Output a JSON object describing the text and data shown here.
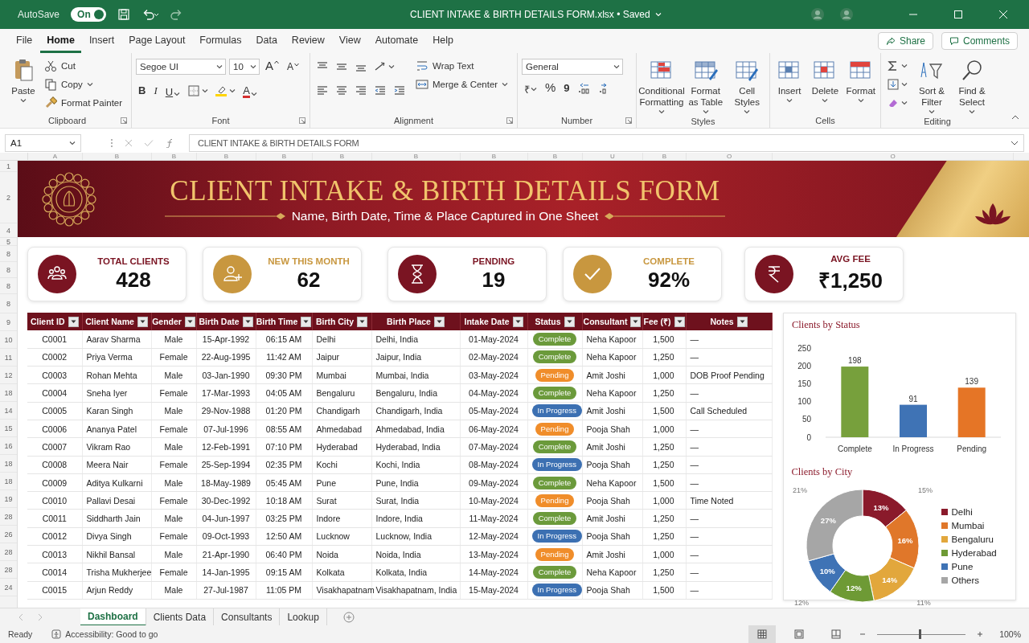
{
  "titlebar": {
    "autosave_label": "AutoSave",
    "autosave": {
      "label": "On",
      "on": true
    },
    "title": "CLIENT INTAKE & BIRTH DETAILS FORM.xlsx • Saved"
  },
  "menu_tabs": [
    {
      "label": "File",
      "selected": false
    },
    {
      "label": "Home",
      "selected": true
    },
    {
      "label": "Insert",
      "selected": false
    },
    {
      "label": "Page Layout",
      "selected": false
    },
    {
      "label": "Formulas",
      "selected": false
    },
    {
      "label": "Data",
      "selected": false
    },
    {
      "label": "Review",
      "selected": false
    },
    {
      "label": "View",
      "selected": false
    },
    {
      "label": "Automate",
      "selected": false
    },
    {
      "label": "Help",
      "selected": false
    }
  ],
  "share_button": "Share",
  "comments_button": "Comments",
  "ribbon": {
    "groups": [
      {
        "label": "Clipboard",
        "items": [
          "Paste",
          "Cut",
          "Copy",
          "Format Painter"
        ]
      },
      {
        "label": "Font",
        "items": [
          "Segoe UI",
          "10",
          "A",
          "A",
          "B",
          "I",
          "U",
          "A"
        ]
      },
      {
        "label": "Alignment",
        "items": [
          "Wrap Text",
          "Merge & Center"
        ]
      },
      {
        "label": "Number",
        "items": [
          "General",
          "₹",
          "%",
          "9"
        ]
      },
      {
        "label": "Styles",
        "items": [
          "Conditional Formatting",
          "Format as Table",
          "Cell Styles"
        ]
      },
      {
        "label": "Cells",
        "items": [
          "Insert",
          "Delete",
          "Format"
        ]
      },
      {
        "label": "Editing",
        "items": [
          "Sort & Filter",
          "Find & Select"
        ]
      }
    ]
  },
  "formula_bar": {
    "name_box": "A1",
    "formula": "CLIENT INTAKE & BIRTH DETAILS FORM"
  },
  "column_letters": [
    "A",
    "B",
    "B",
    "B",
    "B",
    "B",
    "B",
    "B",
    "B",
    "U",
    "B",
    "O",
    "O"
  ],
  "row_numbers": [
    "1",
    "2",
    "4",
    "5",
    "8",
    "8",
    "8",
    "8",
    "9",
    "10",
    "11",
    "12",
    "18",
    "14",
    "15",
    "16",
    "18",
    "18",
    "19",
    "28",
    "26",
    "28",
    "28",
    "24"
  ],
  "banner": {
    "title": "CLIENT INTAKE & BIRTH DETAILS FORM",
    "subtitle": "Name, Birth Date, Time & Place Captured in One Sheet"
  },
  "kpis": [
    {
      "label": "TOTAL CLIENTS",
      "value": "428",
      "color": "#7a1422"
    },
    {
      "label": "NEW THIS MONTH",
      "value": "62",
      "color": "#c8973f"
    },
    {
      "label": "PENDING",
      "value": "19",
      "color": "#7a1422"
    },
    {
      "label": "COMPLETE",
      "value": "92%",
      "color": "#c8973f"
    },
    {
      "label": "AVG FEE",
      "value": "₹1,250",
      "color": "#7a1422"
    }
  ],
  "table": {
    "columns": [
      "Client ID",
      "Client Name",
      "Gender",
      "Birth Date",
      "Birth Time",
      "Birth City",
      "Birth Place",
      "Intake Date",
      "Status",
      "Consultant",
      "Fee (₹)",
      "Notes"
    ],
    "rows": [
      {
        "cells": [
          "C0001",
          "Aarav Sharma",
          "Male",
          "15-Apr-1992",
          "06:15 AM",
          "Delhi",
          "Delhi, India",
          "01-May-2024"
        ],
        "status": {
          "label": "Complete",
          "kind": "complete"
        },
        "rest": [
          "Neha Kapoor",
          "1,500",
          "—"
        ]
      },
      {
        "cells": [
          "C0002",
          "Priya Verma",
          "Female",
          "22-Aug-1995",
          "11:42 AM",
          "Jaipur",
          "Jaipur, India",
          "02-May-2024"
        ],
        "status": {
          "label": "Complete",
          "kind": "complete"
        },
        "rest": [
          "Neha Kapoor",
          "1,250",
          "—"
        ]
      },
      {
        "cells": [
          "C0003",
          "Rohan Mehta",
          "Male",
          "03-Jan-1990",
          "09:30 PM",
          "Mumbai",
          "Mumbai, India",
          "03-May-2024"
        ],
        "status": {
          "label": "Pending",
          "kind": "pending"
        },
        "rest": [
          "Amit Joshi",
          "1,000",
          "DOB Proof Pending"
        ]
      },
      {
        "cells": [
          "C0004",
          "Sneha Iyer",
          "Female",
          "17-Mar-1993",
          "04:05 AM",
          "Bengaluru",
          "Bengaluru, India",
          "04-May-2024"
        ],
        "status": {
          "label": "Complete",
          "kind": "complete"
        },
        "rest": [
          "Neha Kapoor",
          "1,250",
          "—"
        ]
      },
      {
        "cells": [
          "C0005",
          "Karan Singh",
          "Male",
          "29-Nov-1988",
          "01:20 PM",
          "Chandigarh",
          "Chandigarh, India",
          "05-May-2024"
        ],
        "status": {
          "label": "In Progress",
          "kind": "in_progress"
        },
        "rest": [
          "Amit Joshi",
          "1,500",
          "Call Scheduled"
        ]
      },
      {
        "cells": [
          "C0006",
          "Ananya Patel",
          "Female",
          "07-Jul-1996",
          "08:55 AM",
          "Ahmedabad",
          "Ahmedabad, India",
          "06-May-2024"
        ],
        "status": {
          "label": "Pending",
          "kind": "pending"
        },
        "rest": [
          "Pooja Shah",
          "1,000",
          "—"
        ]
      },
      {
        "cells": [
          "C0007",
          "Vikram Rao",
          "Male",
          "12-Feb-1991",
          "07:10 PM",
          "Hyderabad",
          "Hyderabad, India",
          "07-May-2024"
        ],
        "status": {
          "label": "Complete",
          "kind": "complete"
        },
        "rest": [
          "Amit Joshi",
          "1,250",
          "—"
        ]
      },
      {
        "cells": [
          "C0008",
          "Meera Nair",
          "Female",
          "25-Sep-1994",
          "02:35 PM",
          "Kochi",
          "Kochi, India",
          "08-May-2024"
        ],
        "status": {
          "label": "In Progress",
          "kind": "in_progress"
        },
        "rest": [
          "Pooja Shah",
          "1,250",
          "—"
        ]
      },
      {
        "cells": [
          "C0009",
          "Aditya Kulkarni",
          "Male",
          "18-May-1989",
          "05:45 AM",
          "Pune",
          "Pune, India",
          "09-May-2024"
        ],
        "status": {
          "label": "Complete",
          "kind": "complete"
        },
        "rest": [
          "Neha Kapoor",
          "1,500",
          "—"
        ]
      },
      {
        "cells": [
          "C0010",
          "Pallavi Desai",
          "Female",
          "30-Dec-1992",
          "10:18 AM",
          "Surat",
          "Surat, India",
          "10-May-2024"
        ],
        "status": {
          "label": "Pending",
          "kind": "pending"
        },
        "rest": [
          "Pooja Shah",
          "1,000",
          "Time Noted"
        ]
      },
      {
        "cells": [
          "C0011",
          "Siddharth Jain",
          "Male",
          "04-Jun-1997",
          "03:25 PM",
          "Indore",
          "Indore, India",
          "11-May-2024"
        ],
        "status": {
          "label": "Complete",
          "kind": "complete"
        },
        "rest": [
          "Amit Joshi",
          "1,250",
          "—"
        ]
      },
      {
        "cells": [
          "C0012",
          "Divya Singh",
          "Female",
          "09-Oct-1993",
          "12:50 AM",
          "Lucknow",
          "Lucknow, India",
          "12-May-2024"
        ],
        "status": {
          "label": "In Progress",
          "kind": "in_progress"
        },
        "rest": [
          "Pooja Shah",
          "1,250",
          "—"
        ]
      },
      {
        "cells": [
          "C0013",
          "Nikhil Bansal",
          "Male",
          "21-Apr-1990",
          "06:40 PM",
          "Noida",
          "Noida, India",
          "13-May-2024"
        ],
        "status": {
          "label": "Pending",
          "kind": "pending"
        },
        "rest": [
          "Amit Joshi",
          "1,000",
          "—"
        ]
      },
      {
        "cells": [
          "C0014",
          "Trisha Mukherjee",
          "Female",
          "14-Jan-1995",
          "09:15 AM",
          "Kolkata",
          "Kolkata, India",
          "14-May-2024"
        ],
        "status": {
          "label": "Complete",
          "kind": "complete"
        },
        "rest": [
          "Neha Kapoor",
          "1,250",
          "—"
        ]
      },
      {
        "cells": [
          "C0015",
          "Arjun Reddy",
          "Male",
          "27-Jul-1987",
          "11:05 PM",
          "Visakhapatnam",
          "Visakhapatnam, India",
          "15-May-2024"
        ],
        "status": {
          "label": "In Progress",
          "kind": "in_progress"
        },
        "rest": [
          "Pooja Shah",
          "1,500",
          "—"
        ]
      }
    ]
  },
  "charts": [
    {
      "chart_data": {
        "type": "bar",
        "title": "Clients by Status",
        "categories": [
          "Complete",
          "In Progress",
          "Pending"
        ],
        "values": [
          198,
          91,
          139
        ],
        "colors": [
          "#77a03c",
          "#3f73b5",
          "#e57526"
        ],
        "ylim": [
          0,
          250
        ],
        "yticks": [
          0,
          50,
          100,
          150,
          200,
          250
        ],
        "data_labels": true
      }
    },
    {
      "chart_data": {
        "type": "donut",
        "title": "Clients by City",
        "categories": [
          "Delhi",
          "Mumbai",
          "Bengaluru",
          "Hyderabad",
          "Pune",
          "Others"
        ],
        "values": [
          13,
          16,
          14,
          12,
          10,
          27
        ],
        "colors": [
          "#8a1a2b",
          "#e0772a",
          "#e2a73c",
          "#6e9a35",
          "#3f73b5",
          "#a6a6a6"
        ],
        "value_labels": [
          "13%",
          "16%",
          "14%",
          "12%",
          "10%",
          "27%"
        ],
        "annotations": [
          {
            "text": "15%"
          },
          {
            "text": "11%"
          },
          {
            "text": "12%"
          },
          {
            "text": "21%"
          }
        ],
        "legend": "right"
      }
    }
  ],
  "sheet_tabs": [
    {
      "label": "Dashboard",
      "selected": true
    },
    {
      "label": "Clients Data",
      "selected": false
    },
    {
      "label": "Consultants",
      "selected": false
    },
    {
      "label": "Lookup",
      "selected": false
    }
  ],
  "status_bar": {
    "ready": "Ready",
    "accessibility": "Accessibility: Good to go",
    "zoom": {
      "level": 0.48,
      "label": "100%"
    }
  }
}
